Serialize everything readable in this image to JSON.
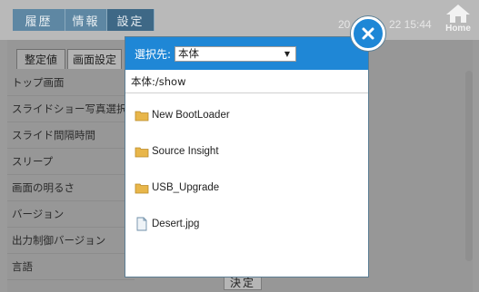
{
  "topbar": {
    "tabs": [
      "履歴",
      "情報",
      "設定"
    ],
    "clock_left": "20",
    "clock_right": "22 15:44",
    "home_label": "Home"
  },
  "panel": {
    "subtabs": [
      "整定値",
      "画面設定"
    ],
    "items": [
      "トップ画面",
      "スライドショー写真選択",
      "スライド間隔時間",
      "スリープ",
      "画面の明るさ",
      "バージョン",
      "出力制御バージョン",
      "言語"
    ],
    "decide_label": "決定"
  },
  "dialog": {
    "select_label": "選択先:",
    "select_value": "本体",
    "path": "本体:/show",
    "entries": [
      {
        "name": "New BootLoader",
        "icon": "folder-icon"
      },
      {
        "name": "Source Insight",
        "icon": "folder-icon"
      },
      {
        "name": "USB_Upgrade",
        "icon": "folder-icon"
      },
      {
        "name": "Desert.jpg",
        "icon": "file-icon"
      }
    ]
  },
  "colors": {
    "accent": "#1f87d6",
    "folder": "#e8b64a",
    "tab": "#5e87a3"
  }
}
